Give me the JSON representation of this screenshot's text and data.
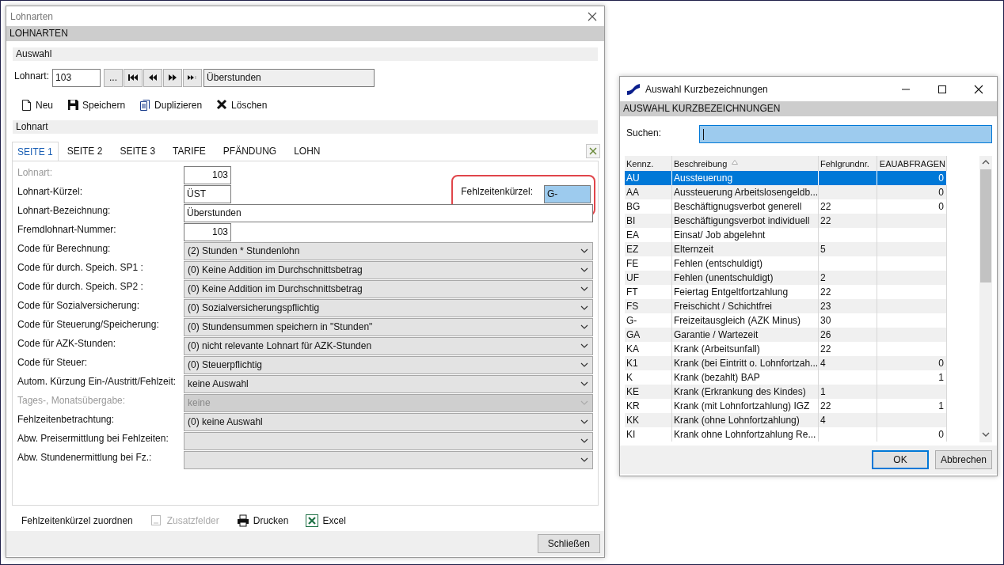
{
  "main_window": {
    "title": "Lohnarten",
    "header": "LOHNARTEN",
    "selection": {
      "title": "Auswahl",
      "label": "Lohnart:",
      "value": "103",
      "browse": "...",
      "name": "Überstunden"
    },
    "toolbar": [
      {
        "label": "Neu",
        "kind": "new"
      },
      {
        "label": "Speichern",
        "kind": "save"
      },
      {
        "label": "Duplizieren",
        "kind": "copy"
      },
      {
        "label": "Löschen",
        "kind": "delete"
      }
    ],
    "section": "Lohnart",
    "tabs": [
      {
        "label": "SEITE 1",
        "selected": true
      },
      {
        "label": "SEITE 2",
        "selected": false
      },
      {
        "label": "SEITE 3",
        "selected": false
      },
      {
        "label": "TARIFE",
        "selected": false
      },
      {
        "label": "PFÄNDUNG",
        "selected": false
      },
      {
        "label": "LOHN",
        "selected": false
      }
    ],
    "fields": [
      {
        "label": "Lohnart:",
        "kind": "number",
        "value": "103",
        "disabled": true
      },
      {
        "label": "Lohnart-Kürzel:",
        "kind": "short",
        "value": "ÜST",
        "disabled": false
      },
      {
        "label": "Lohnart-Bezeichnung:",
        "kind": "text",
        "value": "Überstunden",
        "disabled": false
      },
      {
        "label": "Fremdlohnart-Nummer:",
        "kind": "number",
        "value": "103",
        "disabled": false
      },
      {
        "label": "Code für Berechnung:",
        "kind": "select",
        "value": "(2) Stunden * Stundenlohn",
        "disabled": false
      },
      {
        "label": "Code für durch. Speich. SP1 :",
        "kind": "select",
        "value": "(0) Keine Addition im Durchschnittsbetrag",
        "disabled": false
      },
      {
        "label": "Code für durch. Speich. SP2 :",
        "kind": "select",
        "value": "(0) Keine Addition im Durchschnittsbetrag",
        "disabled": false
      },
      {
        "label": "Code für Sozialversicherung:",
        "kind": "select",
        "value": "(0) Sozialversicherungspflichtig",
        "disabled": false
      },
      {
        "label": "Code für Steuerung/Speicherung:",
        "kind": "select",
        "value": "(0) Stundensummen speichern in \"Stunden\"",
        "disabled": false
      },
      {
        "label": "Code für AZK-Stunden:",
        "kind": "select",
        "value": "(0) nicht relevante Lohnart für AZK-Stunden",
        "disabled": false
      },
      {
        "label": "Code für Steuer:",
        "kind": "select",
        "value": "(0) Steuerpflichtig",
        "disabled": false
      },
      {
        "label": "Autom. Kürzung Ein-/Austritt/Fehlzeit:",
        "kind": "select",
        "value": "keine Auswahl",
        "disabled": false
      },
      {
        "label": "Tages-, Monatsübergabe:",
        "kind": "select",
        "value": "keine",
        "disabled": true
      },
      {
        "label": "Fehlzeitenbetrachtung:",
        "kind": "select",
        "value": "(0) keine Auswahl",
        "disabled": false
      },
      {
        "label": "Abw. Preisermittlung bei Fehlzeiten:",
        "kind": "select",
        "disabled": false
      },
      {
        "label": "Abw. Stundenermittlung bei Fz.:",
        "kind": "select",
        "disabled": false
      }
    ],
    "absence_code": {
      "label": "Fehlzeitenkürzel:",
      "value": "G-",
      "highlighted": true
    },
    "actions": [
      {
        "label": "Fehlzeitenkürzel zuordnen",
        "kind": "plain",
        "disabled": false
      },
      {
        "label": "Zusatzfelder",
        "kind": "fields",
        "disabled": true
      },
      {
        "label": "Drucken",
        "kind": "print",
        "disabled": false
      },
      {
        "label": "Excel",
        "kind": "excel",
        "disabled": false
      }
    ],
    "close_button": "Schließen"
  },
  "dialog": {
    "title": "Auswahl Kurzbezeichnungen",
    "header": "AUSWAHL KURZBEZEICHNUNGEN",
    "search": {
      "label": "Suchen:",
      "focused": true
    },
    "columns": [
      {
        "label": "Kennz.",
        "sorted": false
      },
      {
        "label": "Beschreibung",
        "sorted": true
      },
      {
        "label": "Fehlgrundnr.",
        "sorted": false
      },
      {
        "label": "EAUABFRAGEN",
        "sorted": false
      }
    ],
    "rows": [
      {
        "code": "AU",
        "description": "Aussteuerung",
        "eau": "0",
        "selected": true
      },
      {
        "code": "AA",
        "description": "Aussteuerung Arbeitslosengeldb...",
        "eau": "0",
        "selected": false
      },
      {
        "code": "BG",
        "description": "Beschäftignugsverbot generell",
        "reason": "22",
        "eau": "0",
        "selected": false
      },
      {
        "code": "BI",
        "description": "Beschäftigungsverbot individuell",
        "reason": "22",
        "selected": false
      },
      {
        "code": "EA",
        "description": "Einsat/ Job abgelehnt",
        "selected": false
      },
      {
        "code": "EZ",
        "description": "Elternzeit",
        "reason": "5",
        "selected": false
      },
      {
        "code": "FE",
        "description": "Fehlen (entschuldigt)",
        "selected": false
      },
      {
        "code": "UF",
        "description": "Fehlen (unentschuldigt)",
        "reason": "2",
        "selected": false
      },
      {
        "code": "FT",
        "description": "Feiertag Entgeltfortzahlung",
        "reason": "22",
        "selected": false
      },
      {
        "code": "FS",
        "description": "Freischicht / Schichtfrei",
        "reason": "23",
        "selected": false
      },
      {
        "code": "G-",
        "description": "Freizeitausgleich (AZK Minus)",
        "reason": "30",
        "selected": false
      },
      {
        "code": "GA",
        "description": "Garantie / Wartezeit",
        "reason": "26",
        "selected": false
      },
      {
        "code": "KA",
        "description": "Krank (Arbeitsunfall)",
        "reason": "22",
        "selected": false
      },
      {
        "code": "K1",
        "description": "Krank (bei Eintritt o. Lohnfortzah...",
        "reason": "4",
        "eau": "0",
        "selected": false
      },
      {
        "code": "K",
        "description": "Krank (bezahlt) BAP",
        "eau": "1",
        "selected": false
      },
      {
        "code": "KE",
        "description": "Krank (Erkrankung des Kindes)",
        "reason": "1",
        "selected": false
      },
      {
        "code": "KR",
        "description": "Krank (mit Lohnfortzahlung) IGZ",
        "reason": "22",
        "eau": "1",
        "selected": false
      },
      {
        "code": "KK",
        "description": "Krank (ohne Lohnfortzahlung)",
        "reason": "4",
        "selected": false
      },
      {
        "code": "KI",
        "description": "Krank ohne Lohnfortzahlung Re...",
        "eau": "0",
        "selected": false
      }
    ],
    "buttons": [
      {
        "label": "OK",
        "default": true
      },
      {
        "label": "Abbrechen",
        "default": false
      }
    ]
  }
}
